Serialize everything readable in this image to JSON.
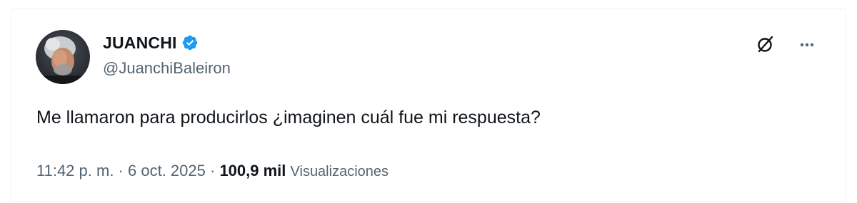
{
  "author": {
    "display_name": "JUANCHI",
    "handle": "@JuanchiBaleiron",
    "verified": true,
    "verified_color": "#1d9bf0"
  },
  "actions": {
    "top_right_icons": [
      "grok-icon",
      "more-options-icon"
    ],
    "more_label": "···"
  },
  "tweet": {
    "text": "Me llamaron para producirlos ¿imaginen cuál fue mi respuesta?"
  },
  "meta": {
    "time": "11:42 p. m.",
    "separator1": " · ",
    "date": "6 oct. 2025",
    "separator2": " · ",
    "views_count": "100,9 mil",
    "views_label": "Visualizaciones"
  },
  "colors": {
    "text_primary": "#0f1419",
    "text_secondary": "#536471",
    "border": "#eff3f4"
  }
}
